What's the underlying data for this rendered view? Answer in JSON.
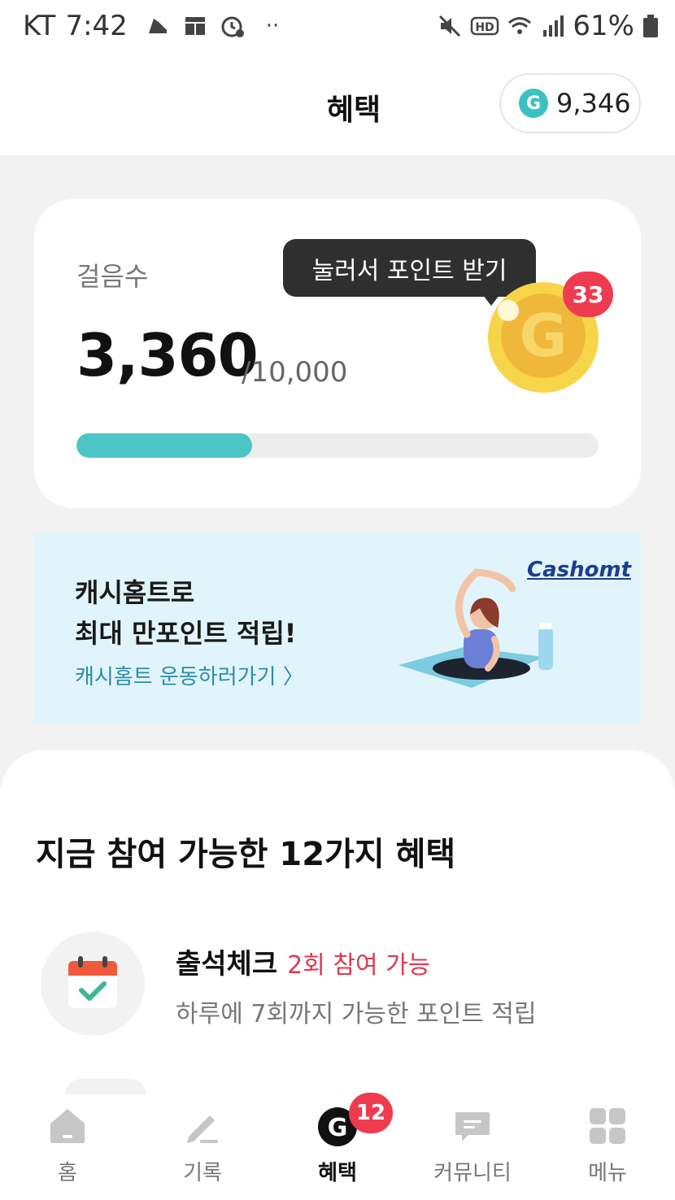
{
  "status_bar": {
    "carrier": "KT",
    "time": "7:42",
    "battery": "61%",
    "icons": [
      "shoe-icon",
      "grid-icon",
      "alarm-icon",
      "more-dots-icon",
      "mute-icon",
      "hd-icon",
      "wifi-icon",
      "signal-icon",
      "battery-icon"
    ]
  },
  "header": {
    "title": "혜택",
    "points": "9,346",
    "points_icon": "G"
  },
  "steps": {
    "label": "걸음수",
    "count": "3,360",
    "goal": "/10,000",
    "progress": 0.336,
    "tooltip": "눌러서 포인트 받기",
    "coin_letter": "G",
    "coin_badge": "33"
  },
  "banner": {
    "title_line1": "캐시홈트로",
    "title_line2": "최대 만포인트 적립!",
    "link": "캐시홈트 운동하러가기 〉",
    "brand": "Cashomt"
  },
  "benefits": {
    "title": "지금 참여 가능한 12가지 혜택",
    "items": [
      {
        "title": "출석체크",
        "tag": "2회 참여 가능",
        "desc": "하루에 7회까지 가능한 포인트 적립",
        "icon": "calendar-check-icon"
      }
    ]
  },
  "bottom_nav": {
    "items": [
      {
        "label": "홈",
        "icon": "home-icon"
      },
      {
        "label": "기록",
        "icon": "pencil-icon"
      },
      {
        "label": "혜택",
        "icon": "g-coin-icon",
        "badge": "12",
        "active": true
      },
      {
        "label": "커뮤니티",
        "icon": "chat-icon"
      },
      {
        "label": "메뉴",
        "icon": "menu-grid-icon"
      }
    ]
  },
  "colors": {
    "accent": "#4cc5c4",
    "badge": "#ef3b4f",
    "tag": "#e0394f",
    "banner_bg": "#e1f4fb"
  }
}
